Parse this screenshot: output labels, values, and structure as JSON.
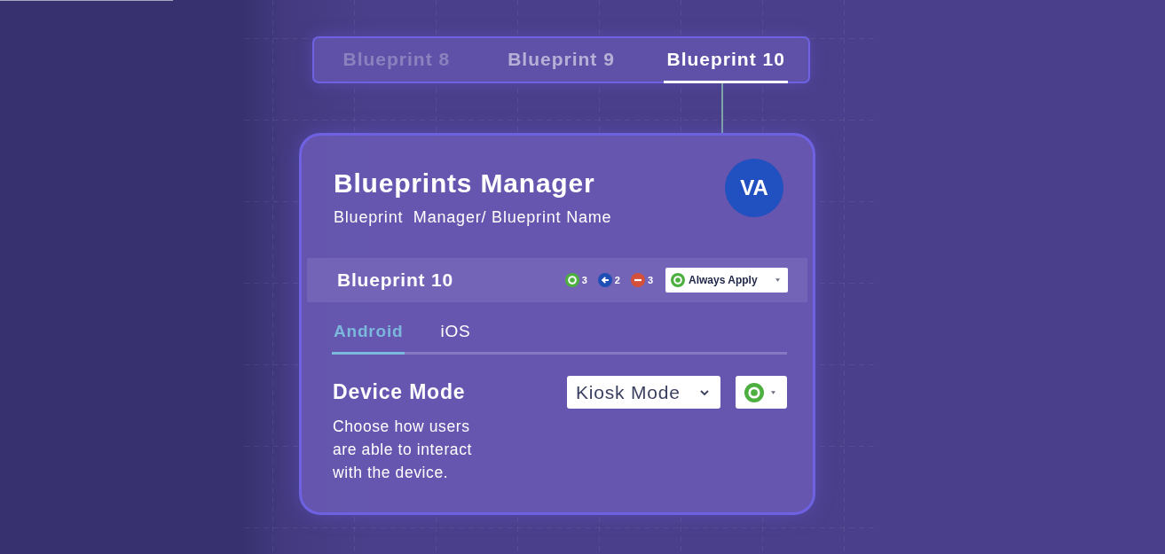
{
  "blueprint_tabs": [
    {
      "label": "Blueprint 8",
      "selected": false,
      "dimmed": true
    },
    {
      "label": "Blueprint 9",
      "selected": false,
      "dimmed": false
    },
    {
      "label": "Blueprint 10",
      "selected": true,
      "dimmed": false
    }
  ],
  "manager_card": {
    "title": "Blueprints Manager",
    "breadcrumb": "Blueprint  Manager/ Blueprint Name",
    "avatar_initials": "VA"
  },
  "blueprint_bar": {
    "name": "Blueprint 10",
    "counts": [
      {
        "kind": "ring",
        "color": "#4caf3f",
        "count": "3"
      },
      {
        "kind": "arrow",
        "color": "#1f4fb5",
        "count": "2"
      },
      {
        "kind": "minus",
        "color": "#d4503b",
        "count": "3"
      }
    ],
    "apply_dropdown": {
      "value": "Always Apply"
    }
  },
  "platform_tabs": [
    {
      "label": "Android",
      "selected": true
    },
    {
      "label": "iOS",
      "selected": false
    }
  ],
  "setting": {
    "title": "Device Mode",
    "description": "Choose how users are able to interact with the device.",
    "mode_dropdown": {
      "value": "Kiosk Mode"
    }
  }
}
